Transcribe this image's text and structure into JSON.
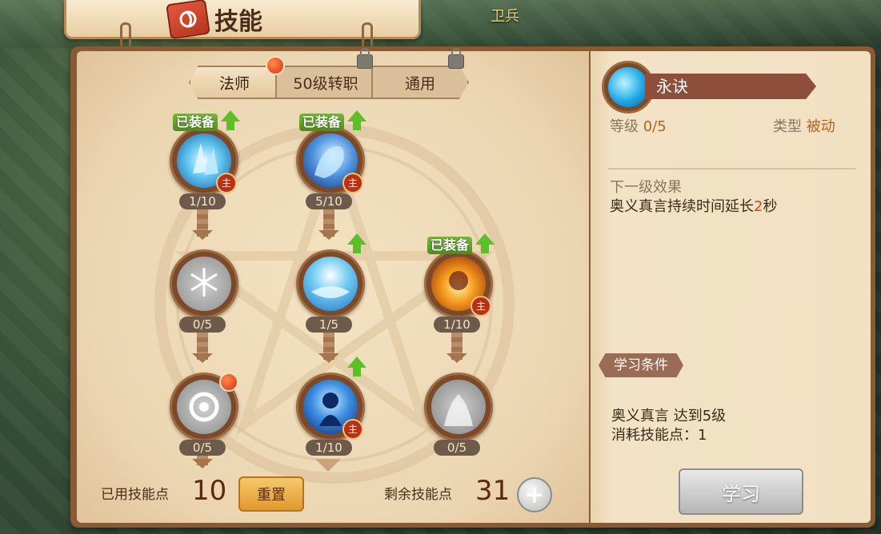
{
  "header": {
    "title": "技能",
    "subtitle": "卫兵"
  },
  "tabs": [
    {
      "label": "法师",
      "active": true,
      "badge": true,
      "locked": false
    },
    {
      "label": "50级转职",
      "active": false,
      "badge": false,
      "locked": true
    },
    {
      "label": "通用",
      "active": false,
      "badge": false,
      "locked": true
    }
  ],
  "skills": {
    "equipped_label": "已装备",
    "main_label": "主",
    "s1": {
      "level": "1/10",
      "icon": "ice-shard-icon",
      "equipped": true,
      "main": true
    },
    "s2": {
      "level": "5/10",
      "icon": "water-hand-icon",
      "equipped": true,
      "main": true
    },
    "s3": {
      "level": "0/5",
      "icon": "snowflake-icon",
      "equipped": false,
      "main": false
    },
    "s4": {
      "level": "1/5",
      "icon": "light-wave-icon",
      "equipped": false,
      "main": false
    },
    "s5": {
      "level": "1/10",
      "icon": "fire-burst-icon",
      "equipped": true,
      "main": true
    },
    "s6": {
      "level": "0/5",
      "icon": "spiral-rune-icon",
      "equipped": false,
      "main": false
    },
    "s7": {
      "level": "1/10",
      "icon": "blue-mage-icon",
      "equipped": false,
      "main": true
    },
    "s8": {
      "level": "0/5",
      "icon": "eruption-icon",
      "equipped": false,
      "main": false
    }
  },
  "footer": {
    "used_label": "已用技能点",
    "used_value": "10",
    "reset_label": "重置",
    "remaining_label": "剩余技能点",
    "remaining_value": "31"
  },
  "detail": {
    "name": "永诀",
    "level_label": "等级",
    "level_value": "0/5",
    "type_label": "类型",
    "type_value": "被动",
    "next_title": "下一级效果",
    "effect_pre": "奥义真言持续时间延长",
    "effect_num": "2",
    "effect_post": "秒",
    "cond_title": "学习条件",
    "cond_line1": "奥义真言 达到5级",
    "cond_line2": "消耗技能点：1",
    "learn_label": "学习"
  },
  "colors": {
    "accent": "#b4631c",
    "highlight": "#d0461a",
    "equipped": "#5cbf2a"
  }
}
